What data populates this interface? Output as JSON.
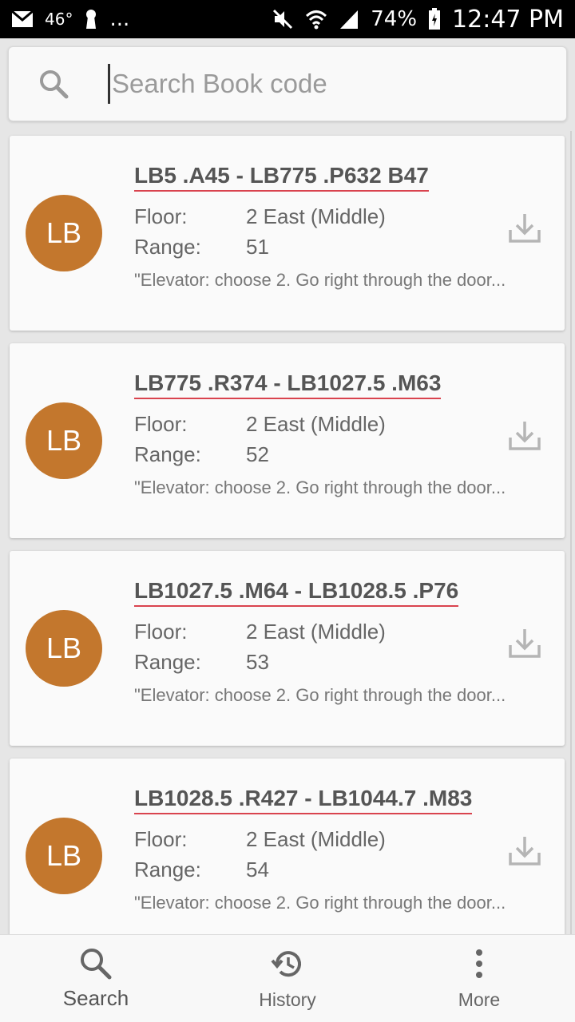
{
  "status_bar": {
    "temperature": "46°",
    "more": "...",
    "battery": "74%",
    "time": "12:47 PM"
  },
  "search": {
    "placeholder": "Search Book code",
    "value": ""
  },
  "cards": [
    {
      "avatar": "LB",
      "title": "LB5 .A45 - LB775 .P632 B47",
      "floor_label": "Floor:",
      "floor": "2 East (Middle)",
      "range_label": "Range:",
      "range": "51",
      "description": "\"Elevator: choose 2.  Go right through the door..."
    },
    {
      "avatar": "LB",
      "title": "LB775 .R374 - LB1027.5 .M63",
      "floor_label": "Floor:",
      "floor": "2 East (Middle)",
      "range_label": "Range:",
      "range": "52",
      "description": "\"Elevator: choose 2.  Go right through the door..."
    },
    {
      "avatar": "LB",
      "title": "LB1027.5 .M64 - LB1028.5 .P76",
      "floor_label": "Floor:",
      "floor": "2 East (Middle)",
      "range_label": "Range:",
      "range": "53",
      "description": "\"Elevator: choose 2.  Go right through the door..."
    },
    {
      "avatar": "LB",
      "title": "LB1028.5 .R427 - LB1044.7 .M83",
      "floor_label": "Floor:",
      "floor": "2 East (Middle)",
      "range_label": "Range:",
      "range": "54",
      "description": "\"Elevator: choose 2.  Go right through the door..."
    }
  ],
  "bottom_nav": {
    "items": [
      {
        "label": "Search",
        "icon": "search-icon",
        "active": true
      },
      {
        "label": "History",
        "icon": "history-icon",
        "active": false
      },
      {
        "label": "More",
        "icon": "more-vert-icon",
        "active": false
      }
    ]
  },
  "colors": {
    "avatar": "#c3772d",
    "title_underline": "#d9434e"
  }
}
